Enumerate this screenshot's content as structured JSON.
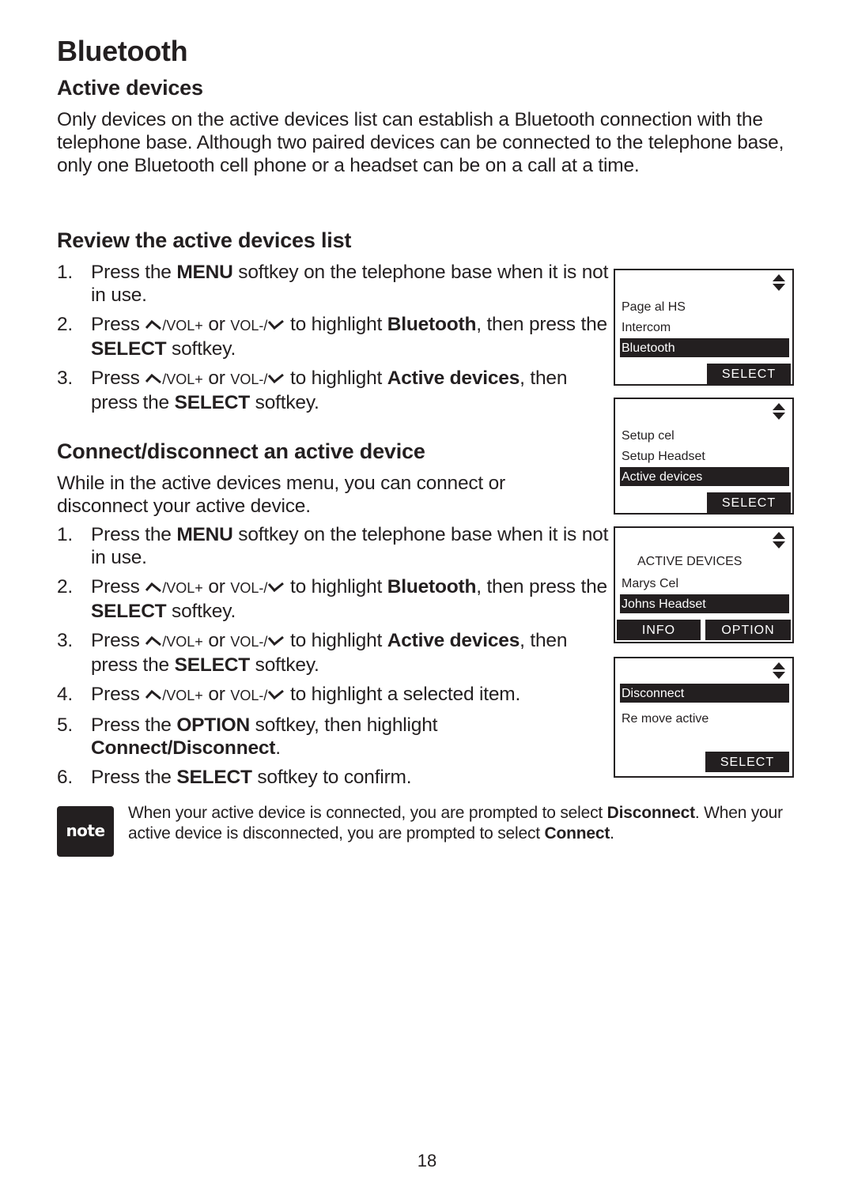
{
  "page": {
    "title": "Bluetooth",
    "page_number": "18"
  },
  "active_devices": {
    "heading": "Active devices",
    "intro": "Only devices on the active devices list can establish a Bluetooth connection with the telephone base. Although two paired devices can be connected to the telephone base, only one Bluetooth cell phone or a headset can be on a call at a time."
  },
  "review": {
    "heading": "Review the active devices list",
    "steps": [
      {
        "num": "1.",
        "pre": "Press the ",
        "bold": "MENU",
        "post": " softkey on the telephone base when it is not in use."
      },
      {
        "num": "2.",
        "press": "Press ",
        "vol_up": "/VOL+",
        "or": " or ",
        "vol_down": "VOL-/",
        "mid": " to highlight ",
        "bold": "Bluetooth",
        "mid2": ", then press the ",
        "bold2": "SELECT",
        "post": " softkey."
      },
      {
        "num": "3.",
        "press": "Press ",
        "vol_up": "/VOL+",
        "or": " or ",
        "vol_down": "VOL-/",
        "mid": " to highlight ",
        "bold": "Active devices",
        "mid2": ", then press the ",
        "bold2": "SELECT",
        "post": " softkey."
      }
    ]
  },
  "connect": {
    "heading": "Connect/disconnect an active device",
    "intro": "While in the active devices menu, you can connect or disconnect your active device.",
    "steps": [
      {
        "num": "1.",
        "pre": "Press the ",
        "bold": "MENU",
        "post": " softkey on the telephone base when it is not in use."
      },
      {
        "num": "2.",
        "press": "Press ",
        "vol_up": "/VOL+",
        "or": " or ",
        "vol_down": "VOL-/",
        "mid": " to highlight ",
        "bold": "Bluetooth",
        "mid2": ", then press the ",
        "bold2": "SELECT",
        "post": " softkey."
      },
      {
        "num": "3.",
        "press": "Press ",
        "vol_up": "/VOL+",
        "or": " or ",
        "vol_down": "VOL-/",
        "mid": " to highlight ",
        "bold": "Active devices",
        "mid2": ", then press the ",
        "bold2": "SELECT",
        "post": " softkey."
      },
      {
        "num": "4.",
        "press": "Press ",
        "vol_up": "/VOL+",
        "or": " or ",
        "vol_down": "VOL-/",
        "post": " to highlight a selected item."
      },
      {
        "num": "5.",
        "pre": "Press the ",
        "bold": "OPTION",
        "mid": " softkey, then highlight ",
        "bold2": "Connect/Disconnect",
        "post": "."
      },
      {
        "num": "6.",
        "pre": "Press the ",
        "bold": "SELECT",
        "post": " softkey to confirm."
      }
    ]
  },
  "screens": [
    {
      "rows": [
        "Page al HS",
        "Intercom",
        "Bluetooth"
      ],
      "highlighted": 2,
      "softkeys": [
        "SELECT"
      ]
    },
    {
      "rows": [
        "Setup cel",
        "Setup Headset",
        "Active devices"
      ],
      "highlighted": 2,
      "softkeys": [
        "SELECT"
      ]
    },
    {
      "title": "ACTIVE DEVICES",
      "rows": [
        "Marys Cel",
        "Johns Headset"
      ],
      "highlighted": 1,
      "softkeys": [
        "INFO",
        "OPTION"
      ]
    },
    {
      "rows": [
        "Disconnect",
        "Re move active"
      ],
      "highlighted": 0,
      "softkeys": [
        "SELECT"
      ]
    }
  ],
  "note": {
    "badge": "note",
    "text_1": "When your active device is connected, you are prompted to select ",
    "bold_1": "Disconnect",
    "text_2": ". When your active device is disconnected, you are prompted to select ",
    "bold_2": "Connect",
    "text_3": "."
  },
  "icons": {
    "up": "up-arrow-key-icon",
    "down": "down-arrow-key-icon",
    "scroll": "scroll-updown-icon"
  },
  "colors": {
    "text": "#231f20",
    "screen_highlight": "#231f20",
    "background": "#ffffff"
  }
}
